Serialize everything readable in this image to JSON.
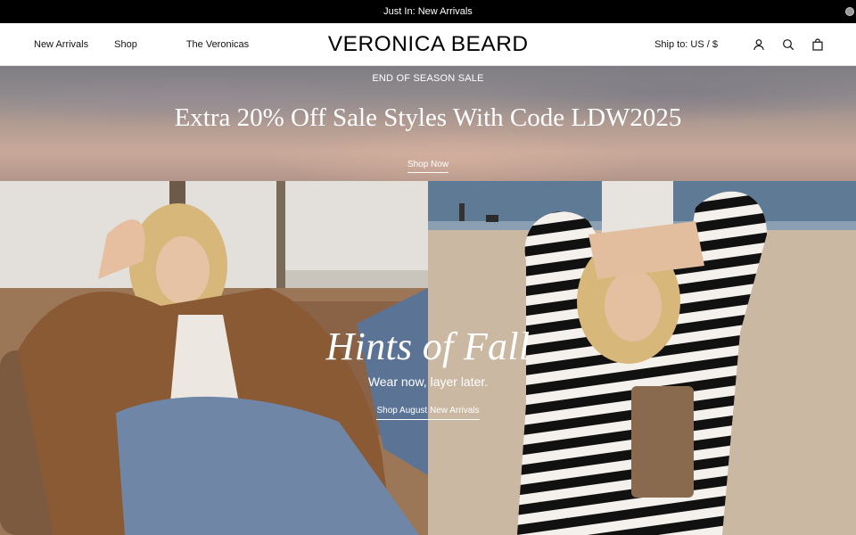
{
  "announcement": {
    "text": "Just In: New Arrivals"
  },
  "header": {
    "nav": [
      "New Arrivals",
      "Shop",
      "The Veronicas"
    ],
    "brand": "VERONICA BEARD",
    "ship_to": "Ship to: US / $",
    "icons": [
      "account-icon",
      "search-icon",
      "cart-icon"
    ]
  },
  "promo": {
    "eyebrow": "END OF SEASON SALE",
    "title": "Extra 20% Off Sale Styles With Code LDW2025",
    "cta": "Shop Now"
  },
  "hero": {
    "title": "Hints of Fall",
    "subtitle": "Wear now, layer later.",
    "cta": "Shop August New Arrivals"
  },
  "colors": {
    "announcement_bg": "#000000",
    "text": "#111111",
    "on_image_text": "#ffffff"
  }
}
